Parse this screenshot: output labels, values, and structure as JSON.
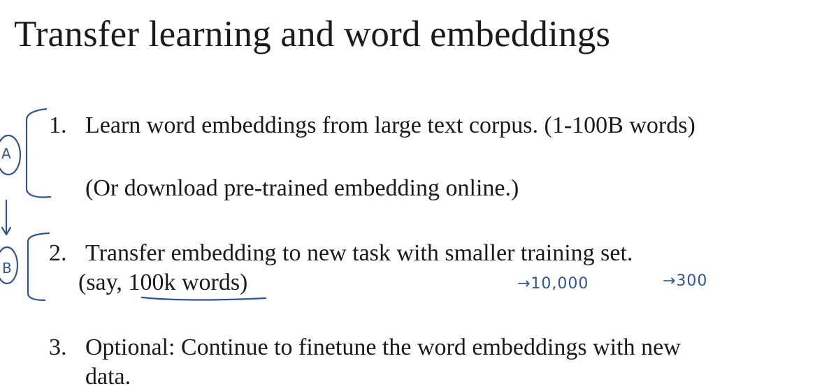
{
  "slide": {
    "title": "Transfer learning and word embeddings",
    "steps": [
      {
        "number": "1.",
        "text": "Learn word embeddings from large text corpus. (1-100B words)"
      },
      {
        "text": "(Or download pre-trained embedding online.)"
      },
      {
        "number": "2.",
        "text": "Transfer embedding to new task with smaller training set."
      },
      {
        "text_before": "(say, ",
        "text_underlined": "100k words",
        "text_after": ")"
      },
      {
        "number": "3.",
        "text": "Optional: Continue to finetune the word embeddings with new"
      },
      {
        "text": "data."
      }
    ],
    "annotations": {
      "group_a": "A",
      "group_b": "B",
      "vocab_size": "→10,000",
      "embedding_dim": "→300"
    },
    "ink_color": "#2f5597"
  }
}
